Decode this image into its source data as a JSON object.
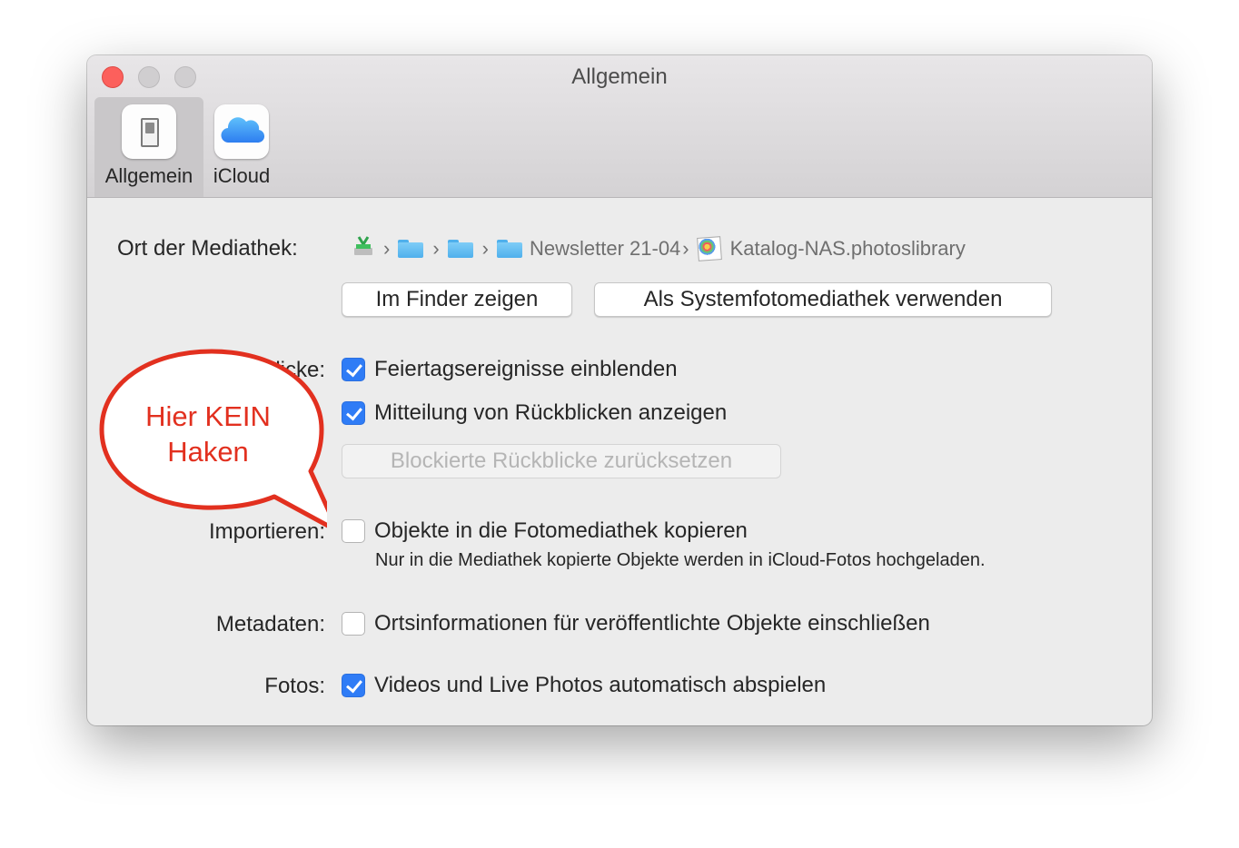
{
  "window": {
    "title": "Allgemein"
  },
  "toolbar": {
    "tabs": [
      {
        "label": "Allgemein",
        "icon": "switch-icon",
        "selected": true
      },
      {
        "label": "iCloud",
        "icon": "icloud-icon",
        "selected": false
      }
    ]
  },
  "library": {
    "label": "Ort der Mediathek:",
    "path": [
      {
        "icon": "nas-drive-icon",
        "name": ""
      },
      {
        "icon": "folder-icon",
        "name": ""
      },
      {
        "icon": "folder-icon",
        "name": ""
      },
      {
        "icon": "folder-icon",
        "name": "Newsletter 21-04"
      },
      {
        "icon": "photos-library-icon",
        "name": "Katalog-NAS.photoslibrary"
      }
    ],
    "show_in_finder_label": "Im Finder zeigen",
    "use_as_system_label": "Als Systemfotomediathek verwenden"
  },
  "memories": {
    "label_visible_fragment": "licke:",
    "holiday_events": {
      "label": "Feiertagsereignisse einblenden",
      "checked": true
    },
    "memory_notifications": {
      "label": "Mitteilung von Rückblicken anzeigen",
      "checked": true
    },
    "reset_blocked_label": "Blockierte Rückblicke zurücksetzen"
  },
  "importing": {
    "label": "Importieren:",
    "copy_items": {
      "label": "Objekte in die Fotomediathek kopieren",
      "checked": false
    },
    "note": "Nur in die Mediathek kopierte Objekte werden in iCloud-Fotos hochgeladen."
  },
  "metadata": {
    "label": "Metadaten:",
    "include_location": {
      "label": "Ortsinformationen für veröffentlichte Objekte einschließen",
      "checked": false
    }
  },
  "photos": {
    "label": "Fotos:",
    "autoplay": {
      "label": "Videos und Live Photos automatisch abspielen",
      "checked": true
    }
  },
  "annotation": {
    "line1": "Hier KEIN",
    "line2": "Haken",
    "color": "#e2301f"
  },
  "colors": {
    "accent": "#2f7cf6",
    "window_bg": "#ececec",
    "close_button": "#fc605c"
  }
}
